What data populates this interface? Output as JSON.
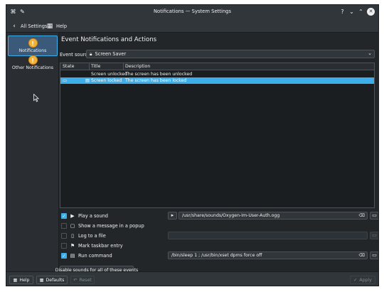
{
  "window": {
    "title": "Notifications — System Settings",
    "controls": [
      "?",
      "⌄",
      "⌃",
      "✕"
    ]
  },
  "toolbar": {
    "back_label": "All Settings",
    "help_label": "Help"
  },
  "sidebar": {
    "items": [
      {
        "label": "Notifications",
        "icon": "notification-bell-icon",
        "active": true
      },
      {
        "label": "Other Notifications",
        "icon": "notification-bell-icon",
        "active": false
      }
    ]
  },
  "main": {
    "heading": "Event Notifications and Actions",
    "event_source_label": "Event source:",
    "event_source_value": "Screen Saver",
    "table": {
      "columns": [
        "State",
        "Title",
        "Description"
      ],
      "rows": [
        {
          "state": "",
          "title": "Screen unlocked",
          "description": "The screen has been unlocked",
          "selected": false
        },
        {
          "state": "▭",
          "title": "Screen locked",
          "description": "The screen has been locked",
          "selected": true
        }
      ]
    },
    "options": [
      {
        "label": "Play a sound",
        "checked": true,
        "icon": "sound-icon",
        "value": "/usr/share/sounds/Oxygen-Im-User-Auth.ogg",
        "has_field": true
      },
      {
        "label": "Show a message in a popup",
        "checked": false,
        "icon": "popup-message-icon",
        "has_field": false
      },
      {
        "label": "Log to a file",
        "checked": false,
        "icon": "log-file-icon",
        "value": "",
        "has_field": true
      },
      {
        "label": "Mark taskbar entry",
        "checked": false,
        "icon": "flag-icon",
        "has_field": false
      },
      {
        "label": "Run command",
        "checked": true,
        "icon": "terminal-icon",
        "value": "/bin/sleep 1 ; /usr/bin/xset dpms force off",
        "has_field": true
      }
    ],
    "disable_sounds_label": "Disable sounds for all of these events"
  },
  "footer": {
    "help_label": "Help",
    "defaults_label": "Defaults",
    "reset_label": "Reset",
    "apply_label": "Apply"
  },
  "colors": {
    "accent": "#3daee9",
    "window_bg": "#2a2e32",
    "view_bg": "#232629",
    "icon_orange": "#f0b23b"
  }
}
